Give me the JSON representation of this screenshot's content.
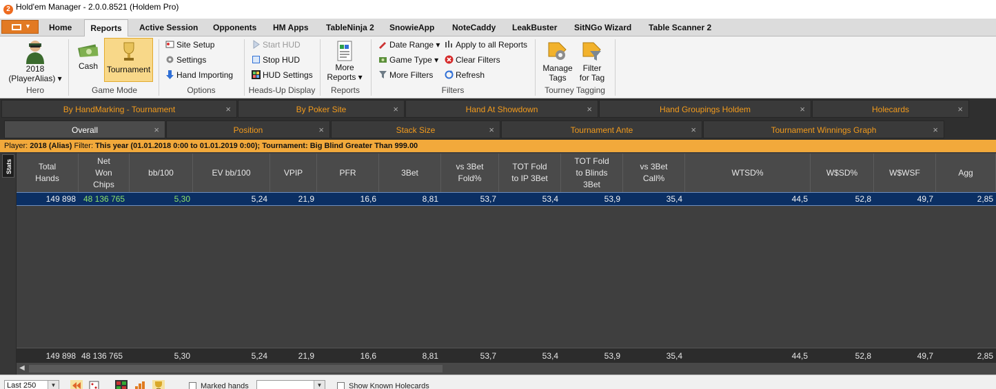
{
  "window": {
    "app_number": "2",
    "title": "Hold'em Manager - 2.0.0.8521 (Holdem Pro)"
  },
  "menu": {
    "tabs": [
      {
        "label": "Home"
      },
      {
        "label": "Reports"
      },
      {
        "label": "Active Session"
      },
      {
        "label": "Opponents"
      },
      {
        "label": "HM Apps"
      },
      {
        "label": "TableNinja 2"
      },
      {
        "label": "SnowieApp"
      },
      {
        "label": "NoteCaddy"
      },
      {
        "label": "LeakBuster"
      },
      {
        "label": "SitNGo Wizard"
      },
      {
        "label": "Table Scanner 2"
      }
    ],
    "active": "Reports"
  },
  "ribbon": {
    "hero": {
      "player_line1": "2018",
      "player_line2": "(PlayerAlias) ▾",
      "group": "Hero"
    },
    "game_mode": {
      "cash": "Cash",
      "tournament": "Tournament",
      "group": "Game Mode"
    },
    "options": {
      "site_setup": "Site Setup",
      "settings": "Settings",
      "hand_importing": "Hand Importing",
      "group": "Options"
    },
    "hud": {
      "start": "Start HUD",
      "stop": "Stop HUD",
      "settings": "HUD Settings",
      "group": "Heads-Up Display"
    },
    "reports": {
      "more_line1": "More",
      "more_line2": "Reports ▾",
      "group": "Reports"
    },
    "filters": {
      "date_range": "Date Range ▾",
      "game_type": "Game Type ▾",
      "more_filters": "More Filters",
      "apply_all": "Apply to all Reports",
      "clear": "Clear Filters",
      "refresh": "Refresh",
      "group": "Filters"
    },
    "tagging": {
      "manage_line1": "Manage",
      "manage_line2": "Tags",
      "filter_line1": "Filter",
      "filter_line2": "for Tag",
      "group": "Tourney Tagging"
    }
  },
  "report_tabs_row1": [
    {
      "label": "By HandMarking - Tournament"
    },
    {
      "label": "By Poker Site"
    },
    {
      "label": "Hand At Showdown"
    },
    {
      "label": "Hand Groupings Holdem"
    },
    {
      "label": "Holecards"
    }
  ],
  "report_tabs_row2": [
    {
      "label": "Overall"
    },
    {
      "label": "Position"
    },
    {
      "label": "Stack Size"
    },
    {
      "label": "Tournament Ante"
    },
    {
      "label": "Tournament Winnings Graph"
    }
  ],
  "close_glyph": "×",
  "filter_bar": {
    "player_prefix": "Player: ",
    "player": "2018 (Alias)",
    "filter_prefix": "  Filter: ",
    "filter": "This year (01.01.2018 0:00 to 01.01.2019 0:00); Tournament: Big Blind Greater Than 999.00"
  },
  "grid": {
    "side_label": "Stats",
    "columns": [
      "Total\nHands",
      "Net\nWon\nChips",
      "bb/100",
      "EV bb/100",
      "VPIP",
      "PFR",
      "3Bet",
      "vs 3Bet\nFold%",
      "TOT Fold\nto IP 3Bet",
      "TOT Fold\nto Blinds\n3Bet",
      "vs 3Bet\nCall%",
      "WTSD%",
      "W$SD%",
      "W$WSF",
      "Agg"
    ],
    "row": [
      "149 898",
      "48 136 765",
      "5,30",
      "5,24",
      "21,9",
      "16,6",
      "8,81",
      "53,7",
      "53,4",
      "53,9",
      "35,4",
      "44,5",
      "52,8",
      "49,7",
      "2,85"
    ],
    "totals": [
      "149 898",
      "48 136 765",
      "5,30",
      "5,24",
      "21,9",
      "16,6",
      "8,81",
      "53,7",
      "53,4",
      "53,9",
      "35,4",
      "44,5",
      "52,8",
      "49,7",
      "2,85"
    ],
    "scroll_left": "◀"
  },
  "bottom": {
    "range": "Last 250",
    "marked_hands": "Marked hands",
    "show_known": "Show Known Holecards"
  }
}
